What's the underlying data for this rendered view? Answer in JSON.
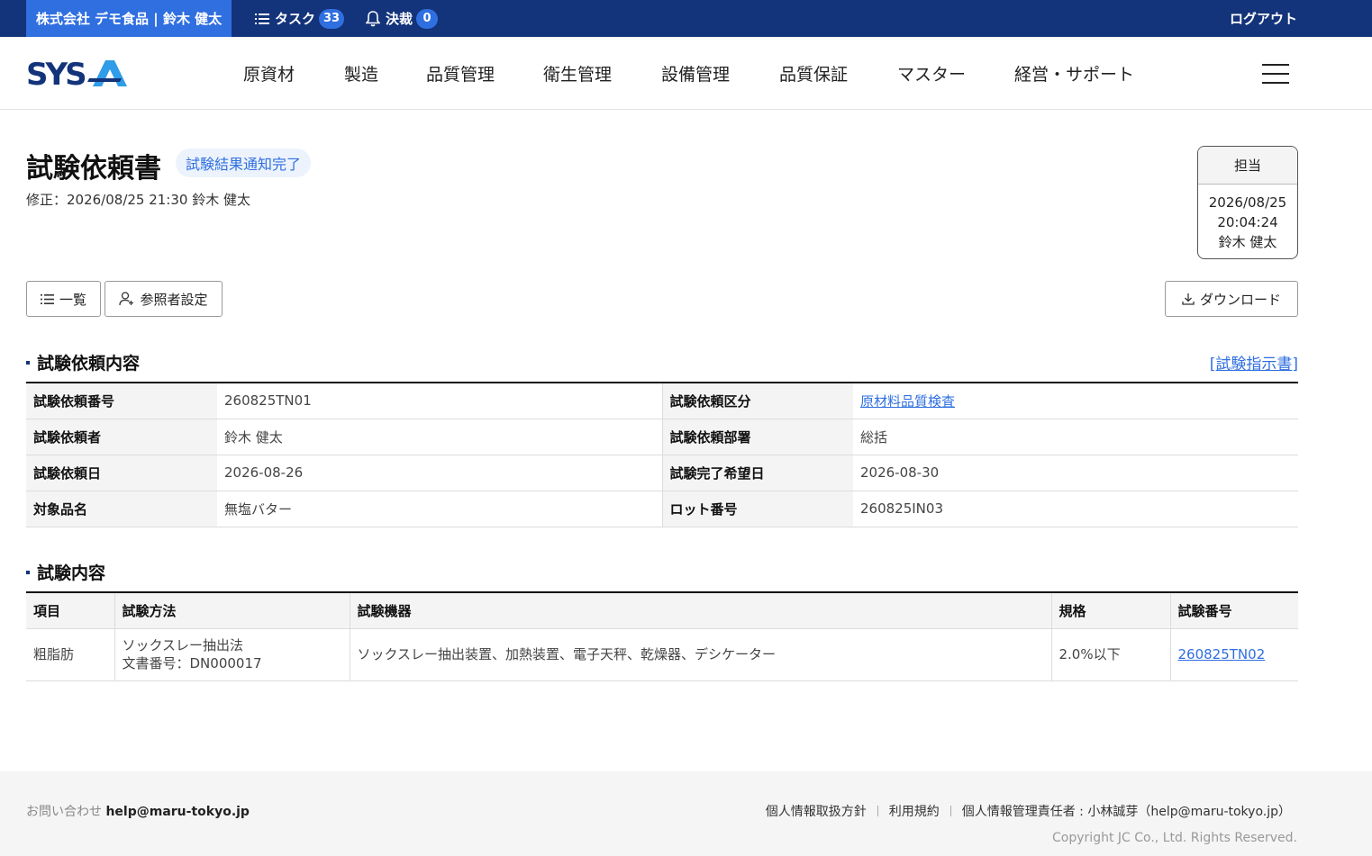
{
  "topbar": {
    "company": "株式会社 デモ食品 | 鈴木 健太",
    "tasks_label": "タスク",
    "tasks_count": "33",
    "approvals_label": "決裁",
    "approvals_count": "0",
    "logout": "ログアウト",
    "bg_color": "#13337a",
    "accent_color": "#2f6fe0"
  },
  "nav": {
    "logo": "SYSA",
    "items": [
      "原資材",
      "製造",
      "品質管理",
      "衛生管理",
      "設備管理",
      "品質保証",
      "マスター",
      "経営・サポート"
    ]
  },
  "header": {
    "title": "試験依頼書",
    "status": "試験結果通知完了",
    "modified": "修正：2026/08/25 21:30 鈴木 健太"
  },
  "approval": {
    "label": "担当",
    "date": "2026/08/25",
    "time": "20:04:24",
    "name": "鈴木 健太"
  },
  "buttons": {
    "list": "一覧",
    "viewers": "参照者設定",
    "download": "ダウンロード"
  },
  "request_section": {
    "title": "試験依頼内容",
    "link": "[試験指示書]",
    "rows": [
      {
        "l1": "試験依頼番号",
        "v1": "260825TN01",
        "l2": "試験依頼区分",
        "v2": "原材料品質検査"
      },
      {
        "l1": "試験依頼者",
        "v1": "鈴木 健太",
        "l2": "試験依頼部署",
        "v2": "総括"
      },
      {
        "l1": "試験依頼日",
        "v1": "2026-08-26",
        "l2": "試験完了希望日",
        "v2": "2026-08-30"
      },
      {
        "l1": "対象品名",
        "v1": "無塩バター",
        "l2": "ロット番号",
        "v2": "260825IN03"
      }
    ]
  },
  "tests_section": {
    "title": "試験内容",
    "columns": [
      "項目",
      "試験方法",
      "試験機器",
      "規格",
      "試験番号"
    ],
    "rows": [
      {
        "item": "粗脂肪",
        "method": "ソックスレー抽出法",
        "document": "文書番号：DN000017",
        "equipment": "ソックスレー抽出装置、加熱装置、電子天秤、乾燥器、デシケーター",
        "spec": "2.0%以下",
        "test_no": "260825TN02"
      }
    ]
  },
  "footer": {
    "contact_label": "お問い合わせ",
    "contact_email": "help@maru-tokyo.jp",
    "privacy_policy": "個人情報取扱方針",
    "terms": "利用規約",
    "privacy_officer": "個人情報管理責任者 : 小林誠芽（help@maru-tokyo.jp）",
    "copyright": "Copyright JC Co., Ltd. Rights Reserved."
  }
}
